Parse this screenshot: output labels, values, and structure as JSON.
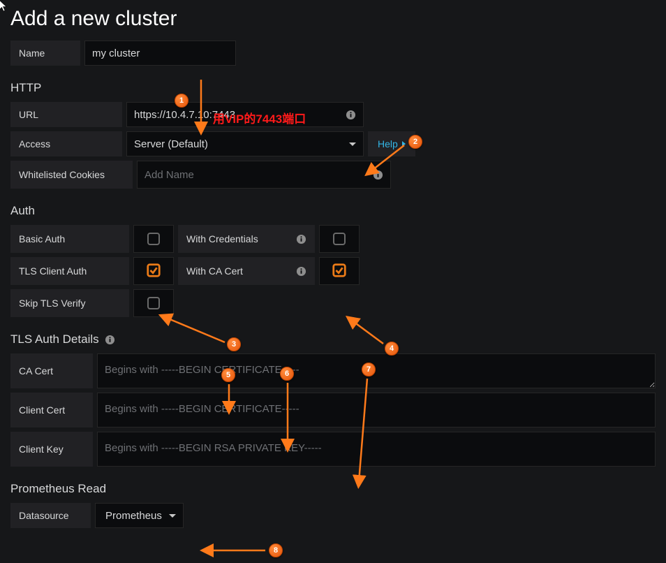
{
  "title": "Add a new cluster",
  "name_label": "Name",
  "name_value": "my cluster",
  "http": {
    "heading": "HTTP",
    "url_label": "URL",
    "url_value": "https://10.4.7.10:7443",
    "access_label": "Access",
    "access_value": "Server (Default)",
    "help_label": "Help",
    "cookies_label": "Whitelisted Cookies",
    "cookies_placeholder": "Add Name"
  },
  "auth": {
    "heading": "Auth",
    "basic_auth": "Basic Auth",
    "with_credentials": "With Credentials",
    "tls_client_auth": "TLS Client Auth",
    "with_ca_cert": "With CA Cert",
    "skip_tls_verify": "Skip TLS Verify",
    "basic_auth_checked": false,
    "with_credentials_checked": false,
    "tls_client_auth_checked": true,
    "with_ca_cert_checked": true,
    "skip_tls_verify_checked": false
  },
  "tls": {
    "heading": "TLS Auth Details",
    "ca_cert_label": "CA Cert",
    "ca_cert_placeholder": "Begins with -----BEGIN CERTIFICATE-----",
    "client_cert_label": "Client Cert",
    "client_cert_placeholder": "Begins with -----BEGIN CERTIFICATE-----",
    "client_key_label": "Client Key",
    "client_key_placeholder": "Begins with -----BEGIN RSA PRIVATE KEY-----"
  },
  "prom": {
    "heading": "Prometheus Read",
    "ds_label": "Datasource",
    "ds_value": "Prometheus"
  },
  "annotation_text": "用VIP的7443端口",
  "badges": [
    "1",
    "2",
    "3",
    "4",
    "5",
    "6",
    "7",
    "8"
  ]
}
